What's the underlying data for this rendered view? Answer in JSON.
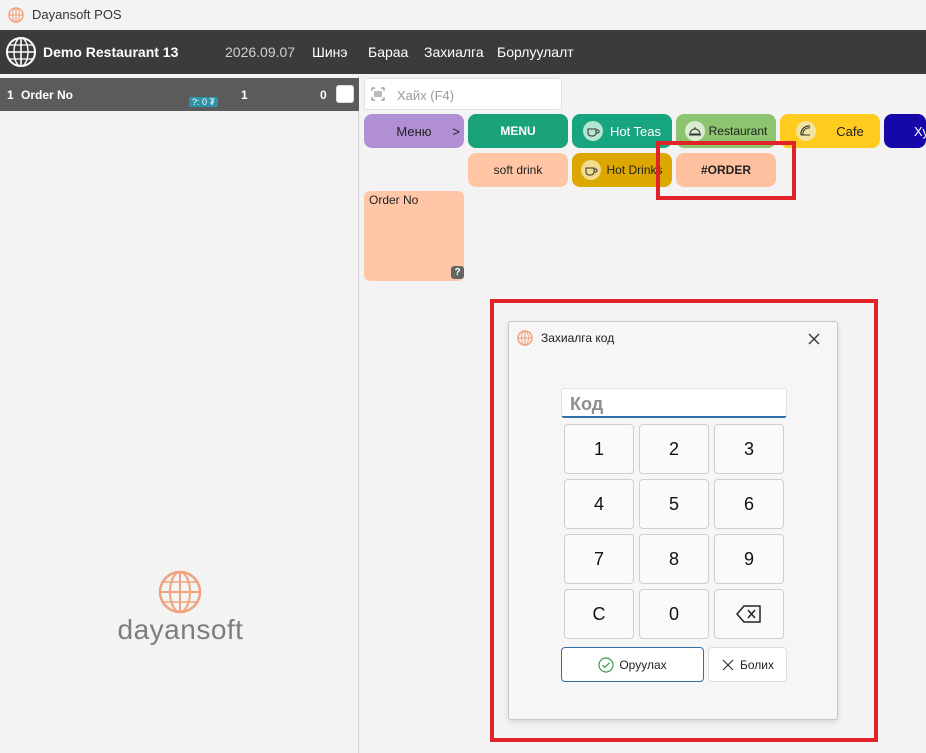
{
  "window": {
    "title": "Dayansoft POS"
  },
  "appbar": {
    "restaurant": "Demo Restaurant 13",
    "date": "2026.09.07",
    "nav": [
      "Шинэ",
      "Бараа",
      "Захиалга",
      "Борлуулалт"
    ]
  },
  "order": {
    "index": "1",
    "label": "Order No",
    "badge": "?: 0 ₮",
    "qty": "1",
    "total": "0"
  },
  "brand": {
    "wordmark": "dayansoft",
    "accent": "#f0a37c"
  },
  "search": {
    "placeholder": "Хайх (F4)"
  },
  "categories": {
    "menu_back": {
      "label": "Меню",
      "arrow": ">",
      "color": "#b08fd4"
    },
    "row1": [
      {
        "label": "MENU",
        "color": "#1aa27a",
        "icon": ""
      },
      {
        "label": "Hot Teas",
        "color": "#17a57f",
        "icon": "cup-icon"
      },
      {
        "label": "Restaurant",
        "color": "#8cc46f",
        "icon": "cloche-icon"
      },
      {
        "label": "Cafe",
        "color": "#ffcb1f",
        "icon": "taco-icon"
      },
      {
        "label": "Ху",
        "color": "#1607a8",
        "icon": ""
      }
    ],
    "row2": [
      {
        "label": "soft drink",
        "color": "#ffc5a5",
        "icon": ""
      },
      {
        "label": "Hot Drinks",
        "color": "#dca800",
        "icon": "cup-icon"
      },
      {
        "label": "#ORDER",
        "color": "#ffc0a0",
        "icon": ""
      }
    ]
  },
  "products": [
    {
      "label": "Order No",
      "badge": "?"
    }
  ],
  "dialog": {
    "title": "Захиалга код",
    "code_placeholder": "Код",
    "keys": [
      "1",
      "2",
      "3",
      "4",
      "5",
      "6",
      "7",
      "8",
      "9",
      "C",
      "0",
      "backspace-icon"
    ],
    "ok_label": "Оруулах",
    "cancel_label": "Болих"
  }
}
